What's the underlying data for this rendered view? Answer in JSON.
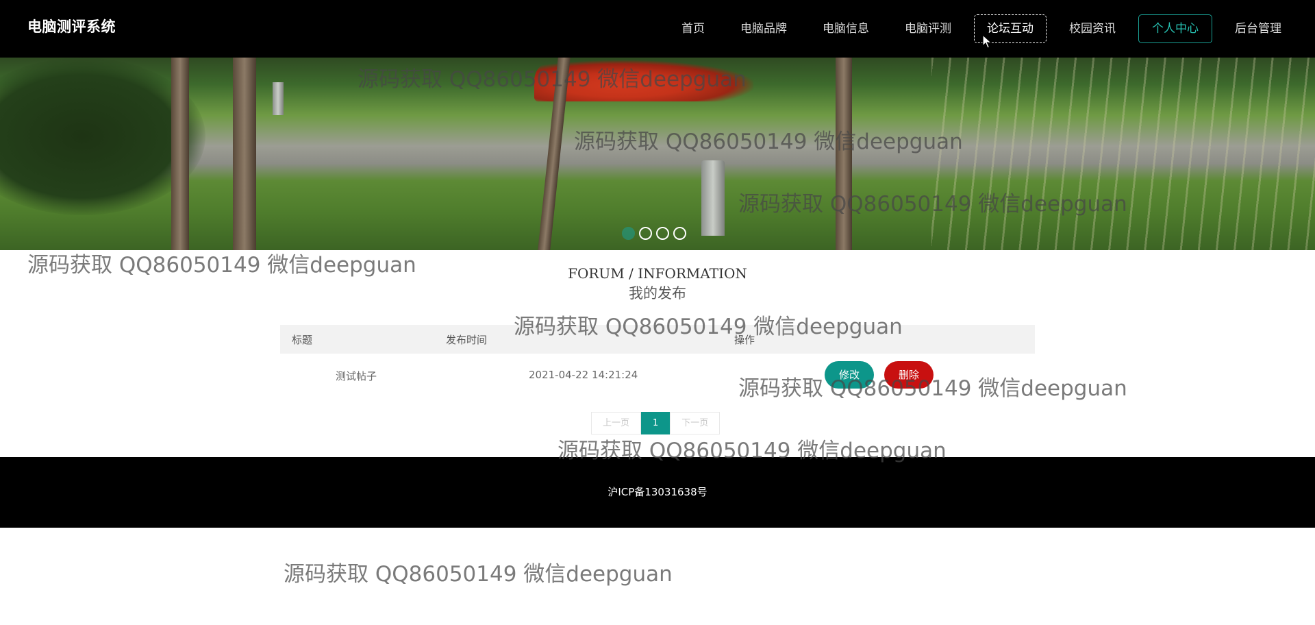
{
  "header": {
    "brand": "电脑测评系统",
    "nav": [
      {
        "label": "首页"
      },
      {
        "label": "电脑品牌"
      },
      {
        "label": "电脑信息"
      },
      {
        "label": "电脑评测"
      },
      {
        "label": "论坛互动"
      },
      {
        "label": "校园资讯"
      },
      {
        "label": "个人中心"
      },
      {
        "label": "后台管理"
      }
    ],
    "active_nav": "个人中心",
    "hovered_nav": "论坛互动",
    "accent_color": "#1aa196"
  },
  "banner": {
    "slide_count": 4,
    "active_slide": 1
  },
  "section": {
    "title_en": "FORUM / INFORMATION",
    "title_cn": "我的发布"
  },
  "table": {
    "columns": [
      "标题",
      "发布时间",
      "操作"
    ],
    "rows": [
      {
        "title": "测试帖子",
        "time": "2021-04-22 14:21:24",
        "edit_label": "修改",
        "delete_label": "删除"
      }
    ]
  },
  "pagination": {
    "prev_label": "上一页",
    "current_page": "1",
    "next_label": "下一页"
  },
  "footer": {
    "icp": "沪ICP备13031638号"
  },
  "watermark": {
    "text": "源码获取 QQ86050149 微信deepguan"
  },
  "colors": {
    "edit_button": "#0d968a",
    "delete_button": "#c81010",
    "page_current": "#0d968a"
  }
}
